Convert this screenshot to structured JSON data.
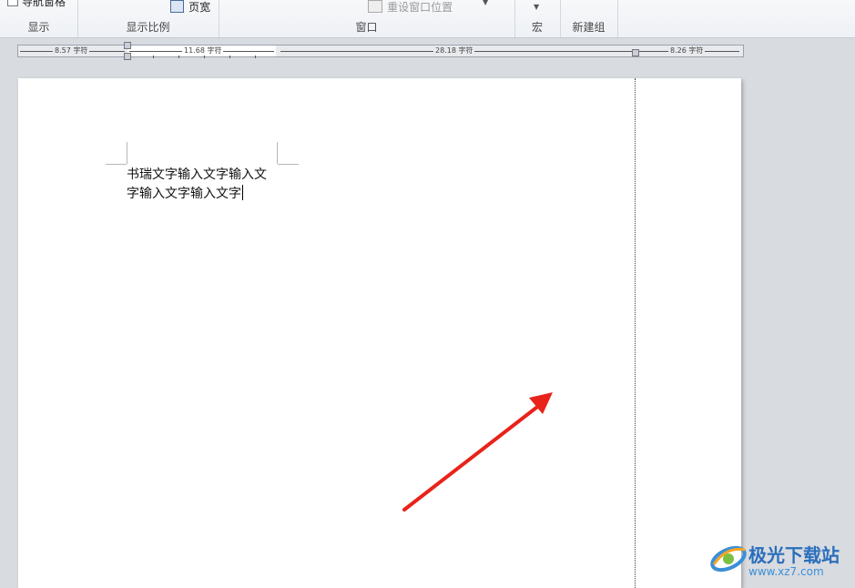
{
  "ribbon": {
    "groups": [
      {
        "label": "显示"
      },
      {
        "label": "显示比例"
      },
      {
        "label": "窗口"
      },
      {
        "label": "宏"
      },
      {
        "label": "新建组"
      }
    ],
    "cut_items": {
      "nav_pane": "导航窗格",
      "page_width": "页宽",
      "reset_window": "重设窗口位置"
    }
  },
  "ruler": {
    "left_margin": "8.57 字符",
    "indent": "11.68 字符",
    "body": "28.18 字符",
    "right_margin": "8.26 字符"
  },
  "document": {
    "line1": "书瑞文字输入文字输入文",
    "line2": "字输入文字输入文字"
  },
  "watermark": {
    "title": "极光下载站",
    "url": "www.xz7.com"
  },
  "colors": {
    "arrow": "#e8231a",
    "page": "#ffffff",
    "background": "#d8dbe0",
    "watermark_blue": "#2a6ebb"
  }
}
